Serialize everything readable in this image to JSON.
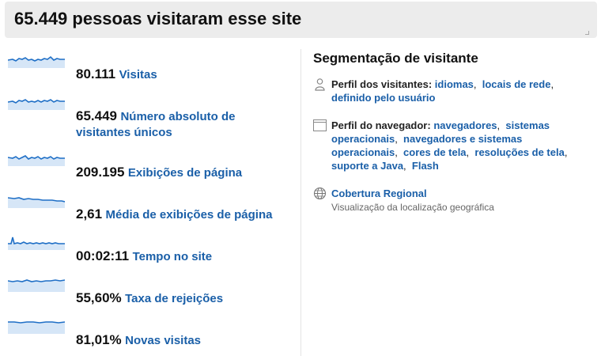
{
  "header": {
    "title": "65.449 pessoas visitaram esse site"
  },
  "metrics": [
    {
      "value": "80.111",
      "label": "Visitas"
    },
    {
      "value": "65.449",
      "label": "Número absoluto de visitantes únicos"
    },
    {
      "value": "209.195",
      "label": "Exibições de página"
    },
    {
      "value": "2,61",
      "label": "Média de exibições de página"
    },
    {
      "value": "00:02:11",
      "label": "Tempo no site"
    },
    {
      "value": "55,60%",
      "label": "Taxa de rejeições"
    },
    {
      "value": "81,01%",
      "label": "Novas visitas"
    }
  ],
  "segmentation": {
    "title": "Segmentação de visitante",
    "visitor_profile": {
      "heading": "Perfil dos visitantes:",
      "links": [
        "idiomas",
        "locais de rede",
        "definido pelo usuário"
      ]
    },
    "browser_profile": {
      "heading": "Perfil do navegador:",
      "links": [
        "navegadores",
        "sistemas operacionais",
        "navegadores e sistemas operacionais",
        "cores de tela",
        "resoluções de tela",
        "suporte a Java",
        "Flash"
      ]
    },
    "regional": {
      "link": "Cobertura Regional",
      "description": "Visualização da localização geográfica"
    }
  },
  "colors": {
    "link": "#1a5fa8",
    "spark_line": "#1f6fc6",
    "spark_fill": "#d6e6f7",
    "header_bg": "#ececec"
  }
}
